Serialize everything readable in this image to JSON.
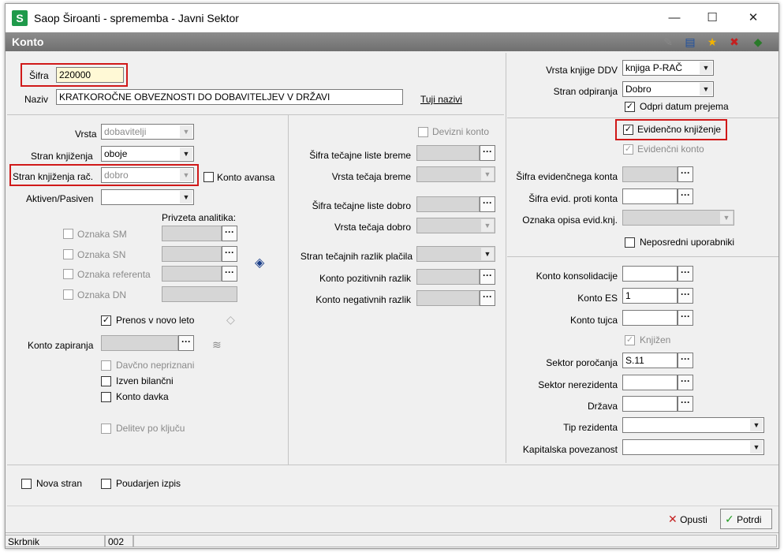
{
  "window": {
    "title": "Saop Široanti - sprememba - Javni Sektor",
    "app_icon": "S",
    "minimize": "—",
    "maximize": "☐",
    "close": "✕"
  },
  "header": {
    "title": "Konto"
  },
  "top": {
    "sifra_label": "Šifra",
    "sifra_value": "220000",
    "naziv_label": "Naziv",
    "naziv_value": "KRATKOROČNE OBVEZNOSTI DO DOBAVITELJEV V DRŽAVI",
    "tuji_nazivi": "Tuji nazivi"
  },
  "col1": {
    "vrsta_label": "Vrsta",
    "vrsta_value": "dobavitelji",
    "stran_knjizenja_label": "Stran knjiženja",
    "stran_knjizenja_value": "oboje",
    "stran_knjizenja_rac_label": "Stran knjiženja rač.",
    "stran_knjizenja_rac_value": "dobro",
    "konto_avansa": "Konto avansa",
    "aktiven_pasiven_label": "Aktiven/Pasiven",
    "aktiven_pasiven_value": "",
    "privzeta_analitika": "Privzeta analitika:",
    "oznaka_sm": "Oznaka SM",
    "oznaka_sn": "Oznaka SN",
    "oznaka_referenta": "Oznaka referenta",
    "oznaka_dn": "Oznaka DN",
    "prenos_novo_leto": "Prenos v novo leto",
    "konto_zapiranja_label": "Konto zapiranja",
    "davcno_nepriznani": "Davčno nepriznani",
    "izven_bilancni": "Izven bilančni",
    "konto_davka": "Konto davka",
    "delitev_po_kljucu": "Delitev po ključu"
  },
  "col2": {
    "devizni_konto": "Devizni konto",
    "sifra_tecajne_breme": "Šifra tečajne liste breme",
    "vrsta_tecaja_breme": "Vrsta tečaja breme",
    "sifra_tecajne_dobro": "Šifra tečajne liste dobro",
    "vrsta_tecaja_dobro": "Vrsta tečaja dobro",
    "stran_tecajnih": "Stran tečajnih razlik plačila",
    "konto_pozitivnih": "Konto pozitivnih razlik",
    "konto_negativnih": "Konto negativnih razlik"
  },
  "col3": {
    "vrsta_knjige_ddv_label": "Vrsta knjige DDV",
    "vrsta_knjige_ddv_value": "knjiga P-RAČ",
    "stran_odpiranja_label": "Stran odpiranja",
    "stran_odpiranja_value": "Dobro",
    "odpri_datum": "Odpri datum prejema",
    "evidencno_knjizenje": "Evidenčno knjiženje",
    "evidencni_konto": "Evidenčni konto",
    "sifra_evid_konta": "Šifra evidenčnega konta",
    "sifra_evid_proti": "Šifra evid. proti konta",
    "oznaka_opisa": "Oznaka opisa evid.knj.",
    "neposredni": "Neposredni uporabniki",
    "konto_konsolidacije": "Konto konsolidacije",
    "konto_es_label": "Konto ES",
    "konto_es_value": "1",
    "konto_tujca": "Konto tujca",
    "knjizen": "Knjižen",
    "sektor_porocanja_label": "Sektor poročanja",
    "sektor_porocanja_value": "S.11",
    "sektor_nerezidenta": "Sektor nerezidenta",
    "drzava": "Država",
    "tip_rezidenta": "Tip rezidenta",
    "kapitalska": "Kapitalska povezanost"
  },
  "bottom": {
    "nova_stran": "Nova stran",
    "poudarjen_izpis": "Poudarjen izpis"
  },
  "buttons": {
    "opusti": "Opusti",
    "potrdi": "Potrdi"
  },
  "status": {
    "skrbnik": "Skrbnik",
    "code": "002"
  },
  "glyphs": {
    "ellipsis": "···",
    "dropdown": "▼",
    "check": "✓"
  },
  "colors": {
    "highlight_border": "#d01919",
    "header_bg": "#7d7d7d",
    "app_icon_bg": "#1f9a4b"
  }
}
